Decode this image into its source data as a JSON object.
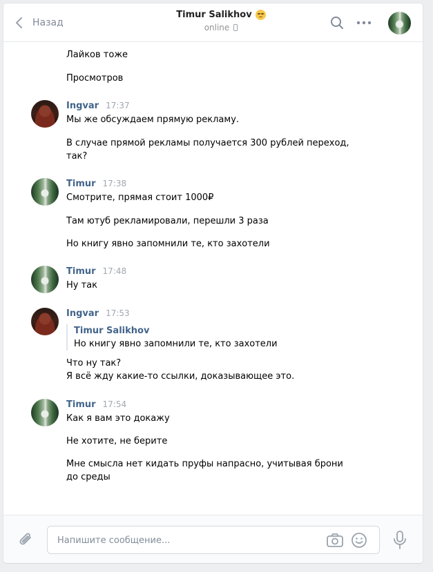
{
  "header": {
    "back_label": "Назад",
    "peer_name": "Timur Salikhov",
    "peer_status": "online"
  },
  "history": {
    "top_messages": [
      "Лайков тоже",
      "Просмотров"
    ],
    "groups": [
      {
        "author": "Ingvar",
        "time": "17:37",
        "avatar": "ingvar",
        "messages": [
          "Мы же обсуждаем прямую рекламу.",
          "В случае прямой рекламы получается 300 рублей переход, так?"
        ]
      },
      {
        "author": "Timur",
        "time": "17:38",
        "avatar": "timur",
        "messages": [
          "Смотрите, прямая стоит 1000₽",
          "Там ютуб рекламировали, перешли 3 раза",
          "Но книгу явно запомнили те, кто захотели"
        ]
      },
      {
        "author": "Timur",
        "time": "17:48",
        "avatar": "timur",
        "messages": [
          "Ну так"
        ]
      },
      {
        "author": "Ingvar",
        "time": "17:53",
        "avatar": "ingvar",
        "reply": {
          "author": "Timur Salikhov",
          "text": "Но книгу явно запомнили те, кто захотели"
        },
        "messages": [
          "Что ну так?\nЯ всё жду какие-то ссылки, доказывающее это."
        ]
      },
      {
        "author": "Timur",
        "time": "17:54",
        "avatar": "timur",
        "messages": [
          "Как я вам это докажу",
          "Не хотите, не берите",
          "Мне смысла нет кидать пруфы напрасно, учитывая брони до среды"
        ]
      }
    ]
  },
  "composer": {
    "placeholder": "Напишите сообщение..."
  },
  "icons": {
    "back": "chevron-left-icon",
    "search": "search-icon",
    "more": "more-horizontal-icon",
    "attach": "paperclip-icon",
    "camera": "camera-icon",
    "emoji": "smile-icon",
    "mic": "microphone-icon"
  },
  "colors": {
    "author_link": "#42648b",
    "time": "#a0a7b0",
    "background": "#edeef0"
  }
}
